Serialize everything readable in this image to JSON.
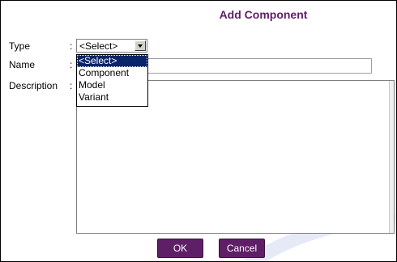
{
  "form": {
    "title": "Add Component",
    "type_label": "Type",
    "name_label": "Name",
    "description_label": "Description",
    "colon": ":",
    "type_selected": "<Select>",
    "type_options": [
      "<Select>",
      "Component",
      "Model",
      "Variant"
    ],
    "name_value": "",
    "description_value": ""
  },
  "buttons": {
    "ok_label": "OK",
    "cancel_label": "Cancel"
  },
  "colors": {
    "accent": "#5e1f66",
    "highlight": "#0a246a"
  }
}
